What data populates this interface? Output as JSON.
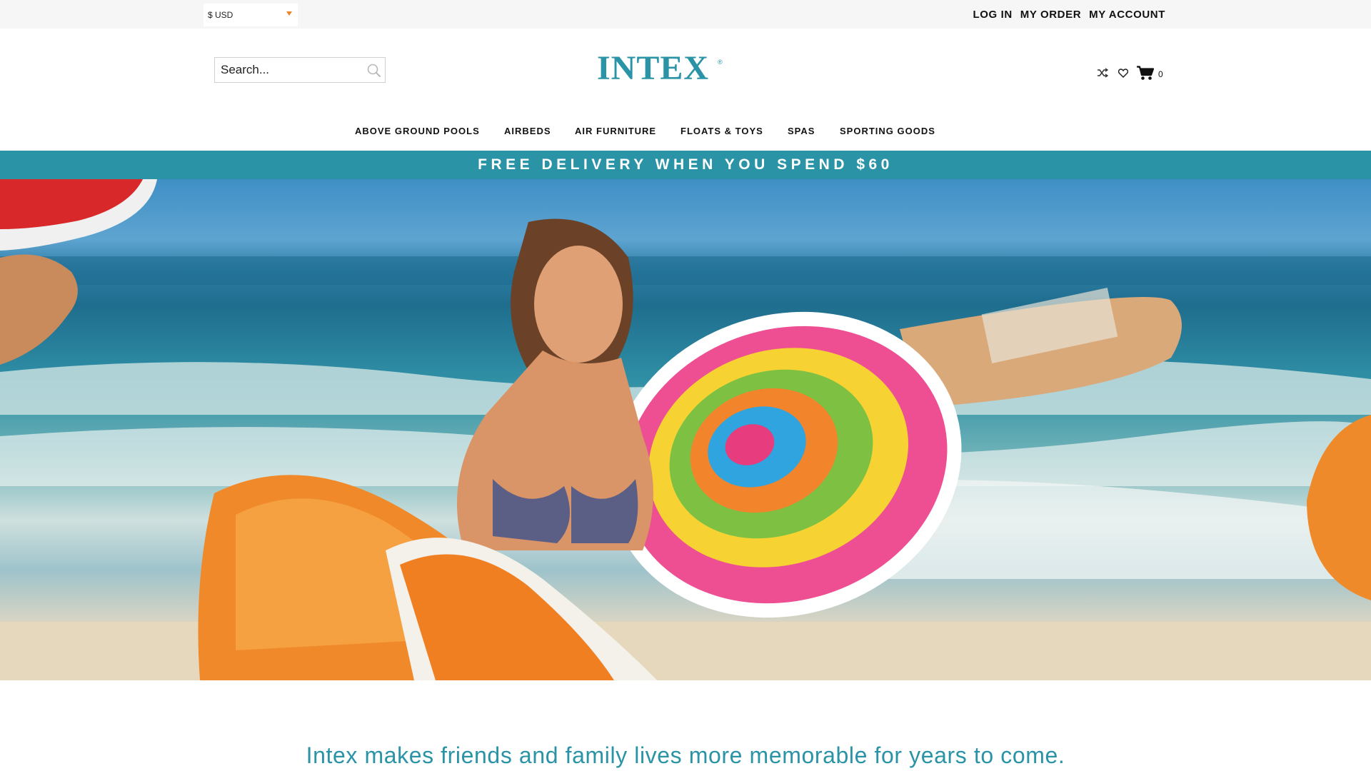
{
  "topbar": {
    "currency": "$ USD",
    "links": {
      "login": "LOG IN",
      "my_order": "MY ORDER",
      "my_account": "MY ACCOUNT"
    }
  },
  "header": {
    "search_placeholder": "Search...",
    "logo_text": "INTEX",
    "logo_mark": "®",
    "cart_count": "0",
    "icons": [
      "shuffle-icon",
      "heart-icon",
      "cart-icon"
    ]
  },
  "nav": {
    "items": [
      "ABOVE GROUND POOLS",
      "AIRBEDS",
      "AIR FURNITURE",
      "FLOATS & TOYS",
      "SPAS",
      "SPORTING GOODS"
    ]
  },
  "promo": {
    "text": "FREE DELIVERY WHEN YOU SPEND $60"
  },
  "tagline": {
    "text": "Intex makes friends and family lives more memorable for years to come."
  },
  "colors": {
    "brand": "#2a94a6",
    "topbar_bg": "#f6f6f6",
    "currency_caret": "#e8862b"
  }
}
